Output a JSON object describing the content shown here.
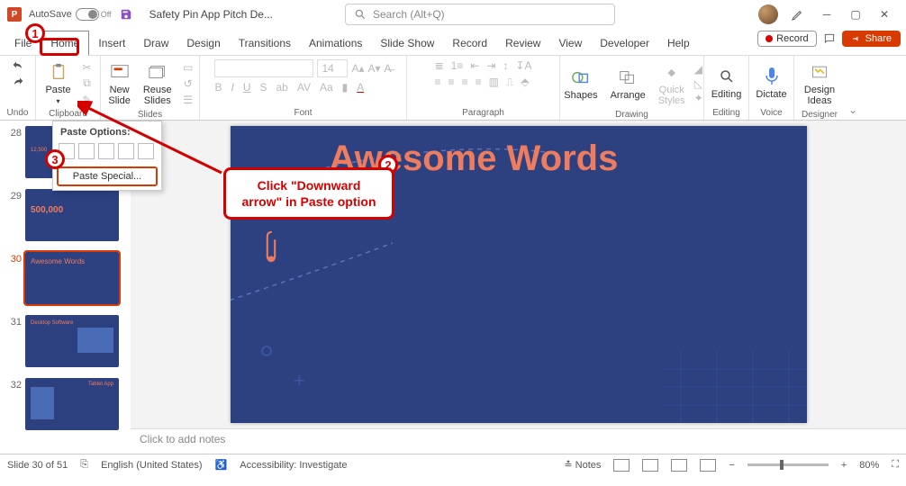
{
  "title_bar": {
    "autosave_label": "AutoSave",
    "autosave_state": "Off",
    "document_title": "Safety Pin App Pitch De...",
    "search_placeholder": "Search (Alt+Q)"
  },
  "tabs": {
    "items": [
      "File",
      "Home",
      "Insert",
      "Draw",
      "Design",
      "Transitions",
      "Animations",
      "Slide Show",
      "Record",
      "Review",
      "View",
      "Developer",
      "Help"
    ],
    "active": "Home",
    "record_label": "Record",
    "share_label": "Share"
  },
  "ribbon": {
    "undo": {
      "label": "Undo"
    },
    "clipboard": {
      "paste": "Paste",
      "label": "Clipboard"
    },
    "slides": {
      "new": "New\nSlide",
      "reuse": "Reuse\nSlides",
      "label": "Slides"
    },
    "font": {
      "size": "14",
      "label": "Font"
    },
    "paragraph": {
      "label": "Paragraph"
    },
    "drawing": {
      "shapes": "Shapes",
      "arrange": "Arrange",
      "quick": "Quick\nStyles",
      "label": "Drawing"
    },
    "editing": {
      "label": "Editing",
      "btn": "Editing"
    },
    "voice": {
      "btn": "Dictate",
      "label": "Voice"
    },
    "designer": {
      "btn": "Design\nIdeas",
      "label": "Designer"
    }
  },
  "paste_menu": {
    "header": "Paste Options:",
    "special": "Paste Special..."
  },
  "thumbs": [
    {
      "num": "28",
      "title": "",
      "sub": "12,500"
    },
    {
      "num": "29",
      "title": "500,000"
    },
    {
      "num": "30",
      "title": "Awesome Words",
      "selected": true
    },
    {
      "num": "31",
      "title": "Desktop Software"
    },
    {
      "num": "32",
      "title": "Tablet App"
    }
  ],
  "slide": {
    "title": "Awesome Words"
  },
  "notes_placeholder": "Click to add notes",
  "status": {
    "slide": "Slide 30 of 51",
    "lang": "English (United States)",
    "access": "Accessibility: Investigate",
    "notes": "Notes",
    "zoom": "80%"
  },
  "annotations": {
    "c1": "1",
    "c2": "2",
    "c3": "3",
    "box": "Click \"Downward arrow\" in Paste option"
  }
}
